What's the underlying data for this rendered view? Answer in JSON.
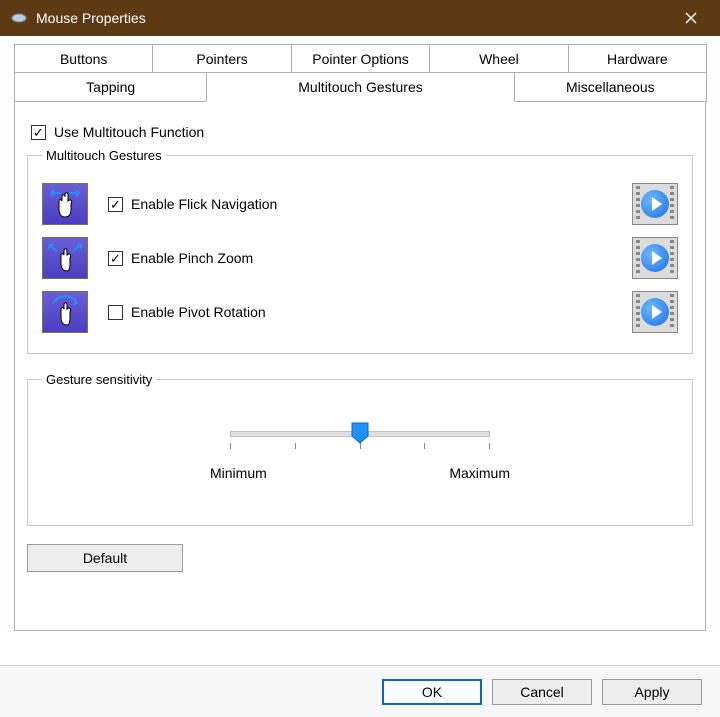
{
  "window": {
    "title": "Mouse Properties"
  },
  "tabs": {
    "row1": [
      "Buttons",
      "Pointers",
      "Pointer Options",
      "Wheel",
      "Hardware"
    ],
    "row2": [
      "Tapping",
      "Multitouch Gestures",
      "Miscellaneous"
    ],
    "active": "Multitouch Gestures"
  },
  "main_checkbox": {
    "label": "Use Multitouch Function",
    "checked": true
  },
  "gestures_group": {
    "legend": "Multitouch Gestures",
    "items": [
      {
        "label": "Enable Flick Navigation",
        "checked": true,
        "icon": "flick"
      },
      {
        "label": "Enable Pinch Zoom",
        "checked": true,
        "icon": "pinch"
      },
      {
        "label": "Enable Pivot Rotation",
        "checked": false,
        "icon": "rotate"
      }
    ]
  },
  "sensitivity_group": {
    "legend": "Gesture sensitivity",
    "min_label": "Minimum",
    "max_label": "Maximum",
    "value": 2,
    "min": 0,
    "max": 4
  },
  "buttons": {
    "default": "Default",
    "ok": "OK",
    "cancel": "Cancel",
    "apply": "Apply"
  }
}
